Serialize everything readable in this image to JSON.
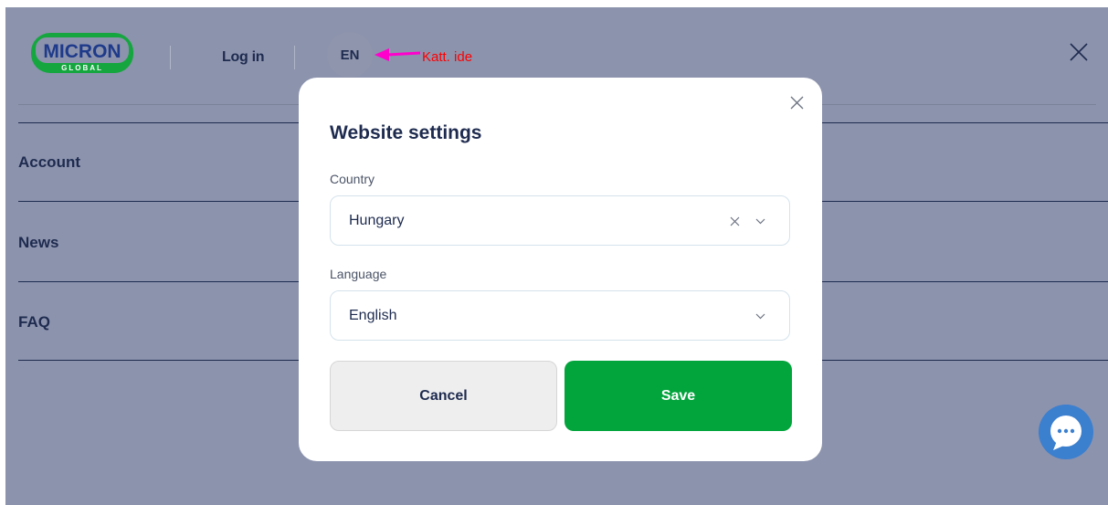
{
  "header": {
    "logo_text": "MICRON",
    "logo_subtext": "GLOBAL",
    "login_label": "Log in",
    "language_code": "EN",
    "annotation_text": "Katt. ide"
  },
  "menu": {
    "items": [
      {
        "label": "Account"
      },
      {
        "label": "News"
      },
      {
        "label": "FAQ"
      }
    ]
  },
  "modal": {
    "title": "Website settings",
    "country_label": "Country",
    "country_value": "Hungary",
    "language_label": "Language",
    "language_value": "English",
    "cancel_label": "Cancel",
    "save_label": "Save"
  },
  "colors": {
    "overlay": "#8c93ad",
    "text_dark": "#1e2b4f",
    "save_green": "#02a43c",
    "annotation_red": "#ff0000",
    "arrow_magenta": "#ff00cc",
    "chat_blue": "#3b7fcf"
  },
  "icons": {
    "menu_close": "close-icon",
    "modal_close": "close-icon",
    "clear": "clear-icon",
    "dropdown": "chevron-down-icon",
    "chat": "chat-bubble-icon"
  }
}
